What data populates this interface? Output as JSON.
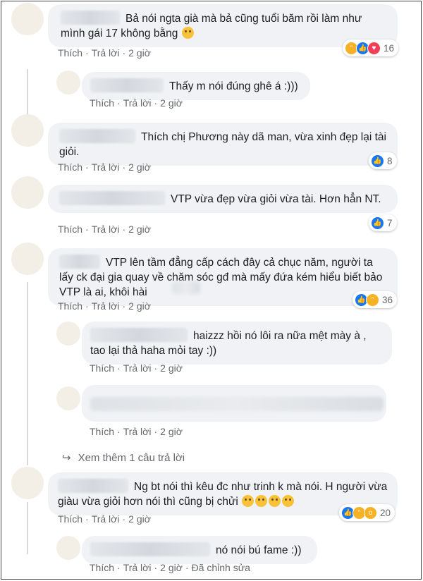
{
  "actions": {
    "like": "Thích",
    "reply": "Trả lời"
  },
  "colors": {
    "bubble": "#f0f2f5",
    "meta": "#65676b",
    "like_blue": "#1877f2",
    "haha_yellow": "#f7b125",
    "love_red": "#f33e58"
  },
  "comments": [
    {
      "text": "Bả nói ngta già mà bả cũng tuổi băm rồi làm như mình gái 17 không bằng",
      "time": "2 giờ",
      "reactions": [
        "haha",
        "like",
        "love"
      ],
      "count": "16"
    },
    {
      "text": "Thấy m nói đúng ghê á :)))",
      "time": "2 giờ"
    },
    {
      "text": "Thích chị Phương này dã man, vừa xinh đẹp lại tài giỏi.",
      "time": "2 giờ",
      "reactions": [
        "like"
      ],
      "count": "8"
    },
    {
      "text": "VTP vừa đẹp vừa giỏi vừa tài. Hơn hẳn NT.",
      "time": "2 giờ",
      "reactions": [
        "like"
      ],
      "count": "7"
    },
    {
      "text": "VTP lên tầm đẳng cấp cách đây cả chục năm, người ta lấy ck đại gia quay về chăm sóc gđ mà mấy đứa kém hiểu biết bảo VTP là ai, khôi hài",
      "time": "2 giờ",
      "reactions": [
        "like",
        "haha"
      ],
      "count": "36"
    },
    {
      "text": "haizzz hồi nó lôi ra nữa mệt mày à , tao lại thả haha mỏi tay :))",
      "time": "2 giờ"
    },
    {
      "text": "",
      "time": "2 giờ"
    },
    {
      "text": "Ng bt nói thì kêu đc như trinh k mà nói. H người vừa giàu vừa giỏi hơn nói thì cũng bị chửi",
      "time": "2 giờ",
      "reactions": [
        "like",
        "haha",
        "wow"
      ],
      "count": "20"
    },
    {
      "text": "nó nói bú fame :))",
      "time": "2 giờ",
      "edited": "Đã chỉnh sửa"
    }
  ],
  "see_more": "Xem thêm 1 câu trả lời",
  "icons": {
    "see_more": "reply-arrow-icon",
    "reactions": [
      "like-reaction-icon",
      "haha-reaction-icon",
      "love-reaction-icon",
      "wow-reaction-icon"
    ]
  }
}
